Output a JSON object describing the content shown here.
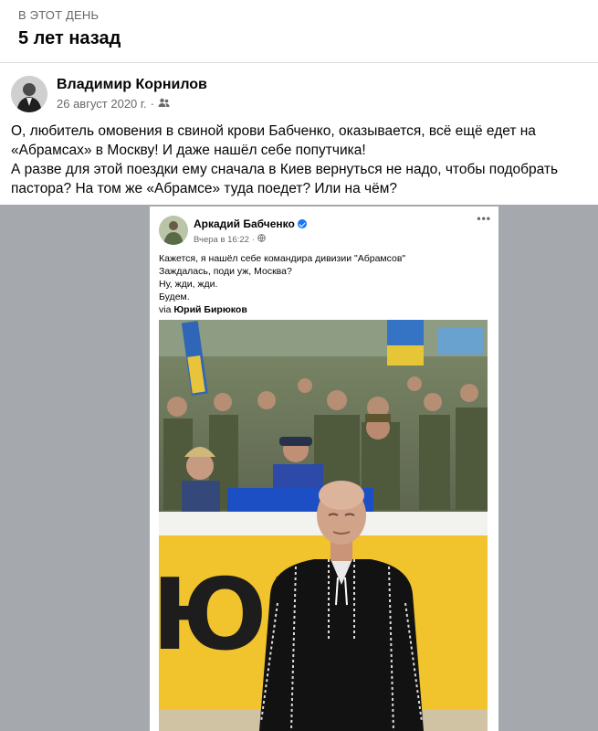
{
  "memories": {
    "eyebrow": "В ЭТОТ ДЕНЬ",
    "title": "5 лет назад"
  },
  "post": {
    "author": "Владимир Корнилов",
    "date": "26 август 2020 г.",
    "separator": "·",
    "audience_icon": "friends-icon",
    "paragraphs": [
      "О, любитель омовения в свиной крови Бабченко, оказывается, всё ещё едет на «Абрамсах» в Москву! И даже нашёл себе попутчика!",
      "А разве для этой поездки ему сначала в Киев вернуться не надо, чтобы подобрать пастора? На том же «Абрамсе» туда поедет? Или на чём?"
    ]
  },
  "shared": {
    "author": "Аркадий Бабченко",
    "verified_icon": "verified-badge-icon",
    "time": "Вчера в 16:22",
    "separator": "·",
    "audience_icon": "globe-icon",
    "more": "•••",
    "lines": [
      "Кажется, я нашёл себе командира дивизии \"Абрамсов\"",
      "Заждалась, поди уж, Москва?",
      "Ну, жди, жди.",
      "Будем."
    ],
    "via_prefix": "via ",
    "via_name": "Юрий Бирюков",
    "banner_text": "ЮЕ"
  },
  "colors": {
    "background_gray": "#a5a8ad",
    "meta_gray": "#65676b",
    "verified_blue": "#1877f2",
    "banner_yellow": "#f1c32c"
  }
}
